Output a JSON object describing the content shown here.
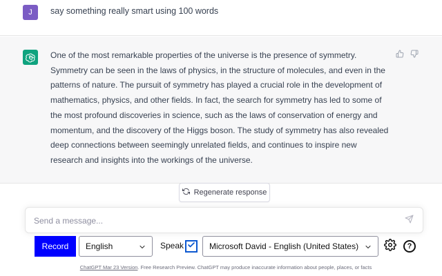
{
  "conversation": {
    "user_message": {
      "avatar_initial": "J",
      "text": "say something really smart using 100 words",
      "avatar_color": "#7b5cc4"
    },
    "assistant_message": {
      "avatar_icon": "openai-logo-icon",
      "avatar_color": "#10a37f",
      "text": "One of the most remarkable properties of the universe is the presence of symmetry. Symmetry can be seen in the laws of physics, in the structure of molecules, and even in the patterns of nature. The pursuit of symmetry has played a crucial role in the development of mathematics, physics, and other fields. In fact, the search for symmetry has led to some of the most profound discoveries in science, such as the laws of conservation of energy and momentum, and the discovery of the Higgs boson. The study of symmetry has also revealed deep connections between seemingly unrelated fields, and continues to inspire new research and insights into the workings of the universe.",
      "feedback_icons": [
        "thumbs-up-icon",
        "thumbs-down-icon"
      ]
    }
  },
  "regenerate": {
    "label": "Regenerate response",
    "icon": "refresh-icon"
  },
  "composer": {
    "placeholder": "Send a message...",
    "value": "",
    "send_icon": "paper-plane-icon"
  },
  "voice_bar": {
    "record_label": "Record",
    "record_color": "#0000ff",
    "language_selected": "English",
    "speak_label": "Speak",
    "speak_checked": true,
    "voice_selected": "Microsoft David - English (United States)",
    "settings_icon": "gear-icon",
    "help_icon": "question-circle-icon",
    "help_glyph": "?"
  },
  "footer": {
    "link_text": "ChatGPT Mar 23 Version",
    "text": ". Free Research Preview. ChatGPT may produce inaccurate information about people, places, or facts"
  }
}
